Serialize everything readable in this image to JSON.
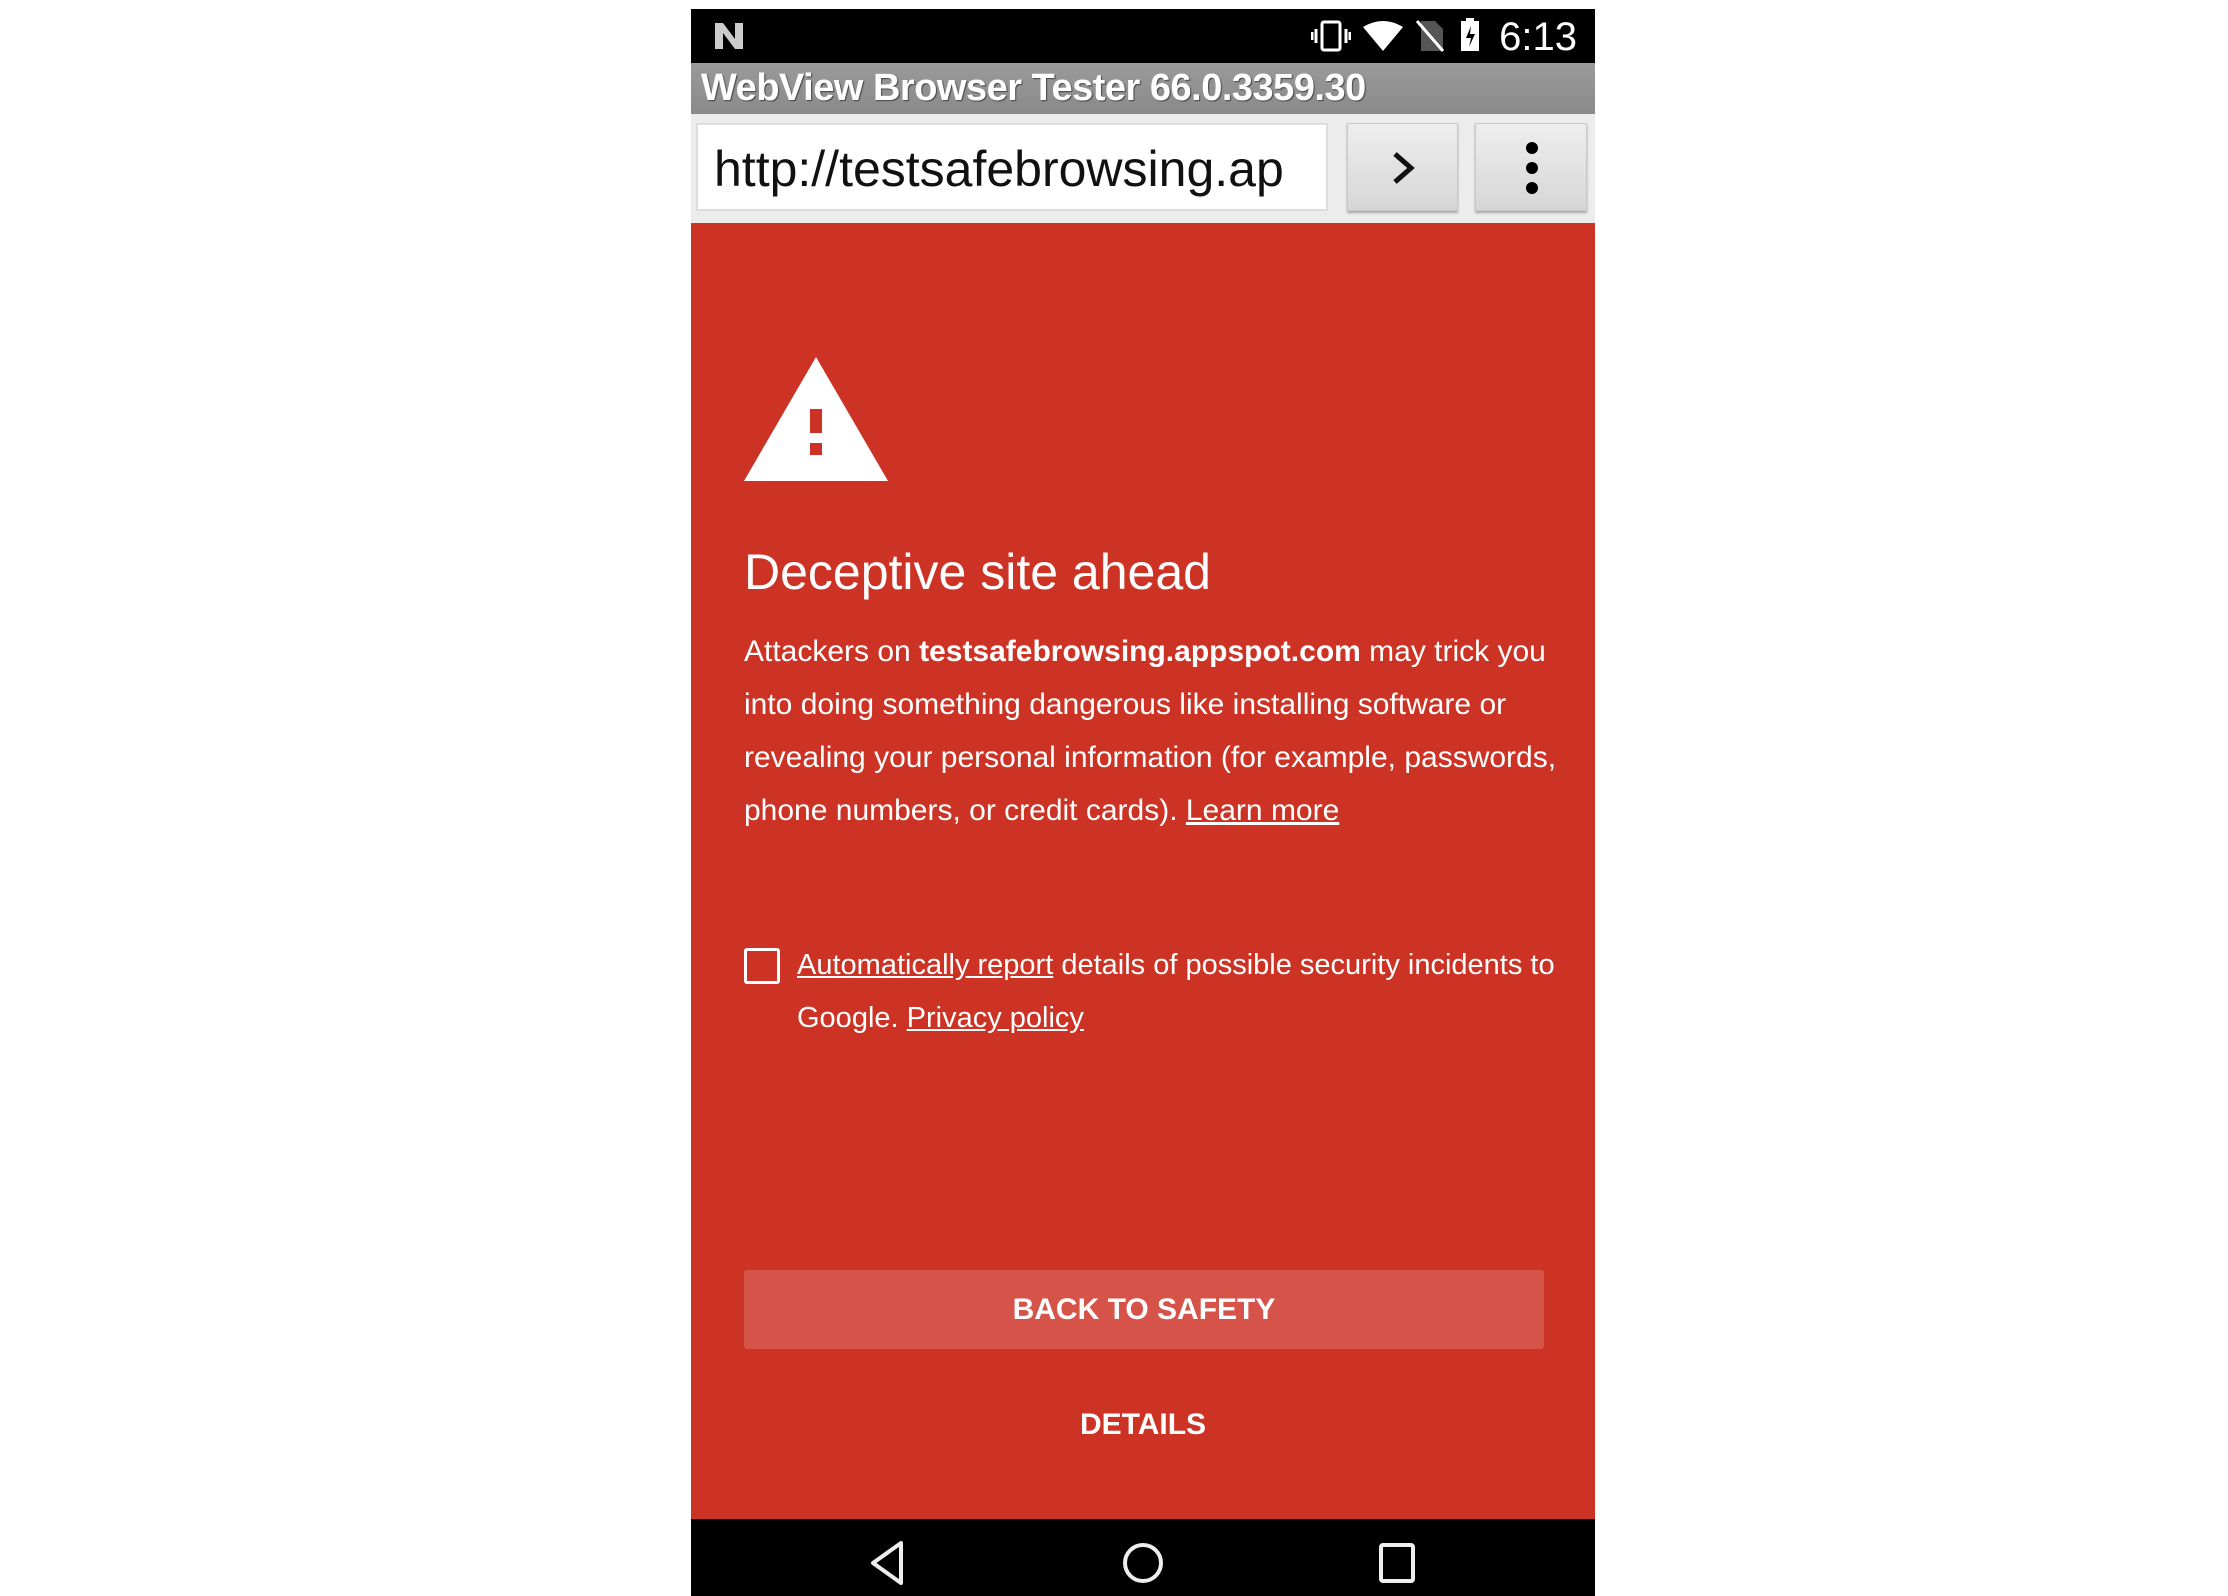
{
  "status_bar": {
    "time": "6:13",
    "icons": [
      "n-logo-icon",
      "vibrate-icon",
      "wifi-icon",
      "no-sim-icon",
      "battery-charging-icon"
    ]
  },
  "app_title": "WebView Browser Tester 66.0.3359.30",
  "url_bar": {
    "value": "http://testsafebrowsing.ap",
    "go_icon": "chevron-right-icon",
    "menu_icon": "overflow-menu-icon"
  },
  "interstitial": {
    "background": "#cc3325",
    "heading": "Deceptive site ahead",
    "body_prefix": "Attackers on ",
    "domain": "testsafebrowsing.appspot.com",
    "body_suffix": " may trick you into doing something dangerous like installing software or revealing your personal information (for example, passwords, phone numbers, or credit cards). ",
    "learn_more": "Learn more",
    "report_checked": false,
    "report_link": "Automatically report",
    "report_text": " details of possible security incidents to Google. ",
    "privacy_link": "Privacy policy",
    "primary_button": "BACK TO SAFETY",
    "details_button": "DETAILS"
  },
  "nav_bar": {
    "icons": [
      "back-icon",
      "home-icon",
      "recents-icon"
    ]
  }
}
